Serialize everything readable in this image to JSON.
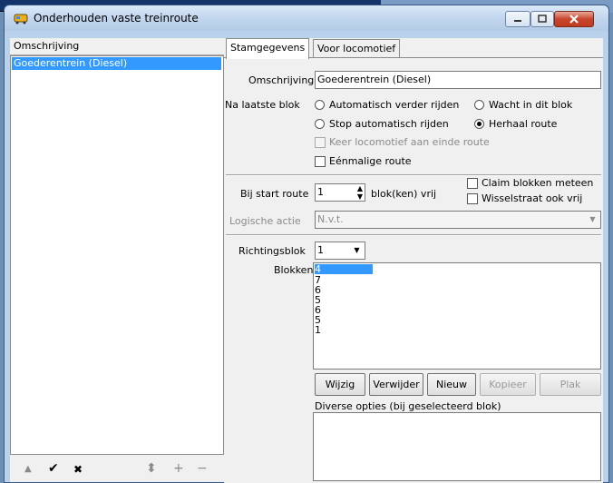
{
  "window": {
    "title": "Onderhouden vaste treinroute"
  },
  "left": {
    "header": "Omschrijving",
    "items": [
      "Goederentrein (Diesel)"
    ],
    "toolbar": {
      "up": "▲",
      "ok": "✔",
      "cancel": "✖",
      "copy": "⬍",
      "add": "+",
      "remove": "−"
    }
  },
  "tabs": [
    "Stamgegevens",
    "Voor locomotief"
  ],
  "form": {
    "omschrijving_label": "Omschrijving",
    "omschrijving_value": "Goederentrein (Diesel)",
    "na_laatste_blok_label": "Na laatste blok",
    "radio_auto": "Automatisch verder rijden",
    "radio_wacht": "Wacht in dit blok",
    "radio_stop": "Stop automatisch rijden",
    "radio_herhaal": "Herhaal route",
    "chk_keer": "Keer locomotief aan einde route",
    "chk_eenmalig": "Eénmalige route",
    "bij_start_label": "Bij start route",
    "bij_start_value": "1",
    "blok_vrij": "blok(ken) vrij",
    "chk_claim": "Claim blokken meteen",
    "chk_wissel": "Wisselstraat ook vrij",
    "logische_label": "Logische actie",
    "logische_value": "N.v.t.",
    "richtingsblok_label": "Richtingsblok",
    "richtingsblok_value": "1",
    "blokken_label": "Blokken",
    "blokken": [
      "4",
      "7",
      "6",
      "5",
      "6",
      "5",
      "1"
    ],
    "buttons": {
      "wijzig": "Wijzig",
      "verwijder": "Verwijder",
      "nieuw": "Nieuw",
      "kopieer": "Kopieer",
      "plak": "Plak"
    },
    "diverse_label": "Diverse opties (bij geselecteerd blok)"
  },
  "colors": {
    "selection": "#3399ff",
    "titlebar": "#c2d6ee",
    "close": "#c8462e"
  }
}
